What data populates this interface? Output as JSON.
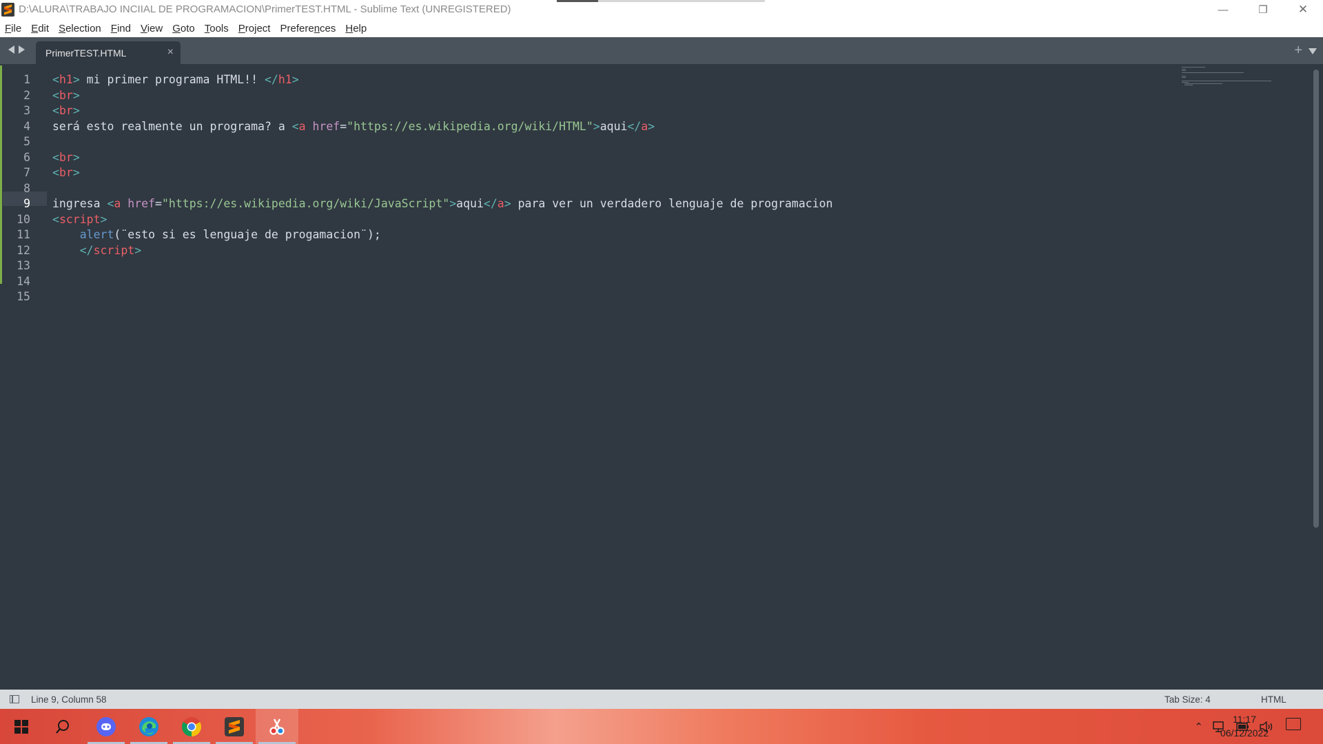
{
  "window": {
    "title": "D:\\ALURA\\TRABAJO INCIIAL DE PROGRAMACION\\PrimerTEST.HTML - Sublime Text (UNREGISTERED)",
    "controls": {
      "minimize": "—",
      "maximize": "❐",
      "close": "✕"
    }
  },
  "menu": {
    "items": [
      {
        "key": "F",
        "rest": "ile"
      },
      {
        "key": "E",
        "rest": "dit"
      },
      {
        "key": "S",
        "rest": "election"
      },
      {
        "key": "F",
        "rest": "ind"
      },
      {
        "key": "V",
        "rest": "iew"
      },
      {
        "key": "G",
        "rest": "oto"
      },
      {
        "key": "T",
        "rest": "ools"
      },
      {
        "key": "P",
        "rest": "roject"
      },
      {
        "key": "Prefere",
        "keyU": "n",
        "rest": "ces"
      },
      {
        "key": "H",
        "rest": "elp"
      }
    ]
  },
  "tabs": {
    "active": {
      "label": "PrimerTEST.HTML",
      "close": "×"
    },
    "new_tab": "+"
  },
  "editor": {
    "active_line": 9,
    "lines": [
      {
        "n": "1"
      },
      {
        "n": "2"
      },
      {
        "n": "3"
      },
      {
        "n": "4"
      },
      {
        "n": "5"
      },
      {
        "n": "6"
      },
      {
        "n": "7"
      },
      {
        "n": "8"
      },
      {
        "n": "9"
      },
      {
        "n": "10"
      },
      {
        "n": "11"
      },
      {
        "n": "12"
      },
      {
        "n": "13"
      },
      {
        "n": "14"
      },
      {
        "n": "15"
      }
    ],
    "code": {
      "l1": {
        "o": "<",
        "tag": "h1",
        "c": ">",
        "text": " mi primer programa HTML!! ",
        "o2": "</",
        "tag2": "h1",
        "c2": ">"
      },
      "l2": {
        "o": "<",
        "tag": "br",
        "c": ">"
      },
      "l3": {
        "o": "<",
        "tag": "br",
        "c": ">"
      },
      "l4": {
        "text": "será esto realmente un programa? a ",
        "o": "<",
        "tag": "a",
        "attr": " href",
        "eq": "=",
        "str": "\"https://es.wikipedia.org/wiki/HTML\"",
        "c": ">",
        "inner": "aqui",
        "o2": "</",
        "tag2": "a",
        "c2": ">"
      },
      "l6": {
        "o": "<",
        "tag": "br",
        "c": ">"
      },
      "l7": {
        "o": "<",
        "tag": "br",
        "c": ">"
      },
      "l9": {
        "text": "ingresa ",
        "o": "<",
        "tag": "a",
        "attr": " href",
        "eq": "=",
        "str": "\"https://es.wikipedia.org/wiki/JavaScript\"",
        "c": ">",
        "inner": "aqui",
        "o2": "</",
        "tag2": "a",
        "c2": ">",
        "after": " para ver un verdadero lenguaje de programacion"
      },
      "l10": {
        "o": "<",
        "tag": "script",
        "c": ">"
      },
      "l11": {
        "indent": "    ",
        "fn": "alert",
        "args": "(¨esto si es lenguaje de progamacion¨);"
      },
      "l12": {
        "indent": "    ",
        "o": "</",
        "tag": "script",
        "c": ">"
      }
    }
  },
  "status": {
    "position": "Line 9, Column 58",
    "tab_size": "Tab Size: 4",
    "syntax": "HTML"
  },
  "taskbar": {
    "apps": [
      "windows-start",
      "search",
      "discord",
      "edge",
      "chrome",
      "sublime-text",
      "snipping-tool"
    ],
    "clock": {
      "time": "11:17",
      "date": "06/12/2022"
    }
  },
  "colors": {
    "editor_bg": "#303841",
    "tag": "#5fb3b3",
    "tag_name": "#ec5f67",
    "attribute": "#c594c5",
    "string": "#99c794",
    "function": "#6699cc",
    "text": "#d8dee9"
  }
}
